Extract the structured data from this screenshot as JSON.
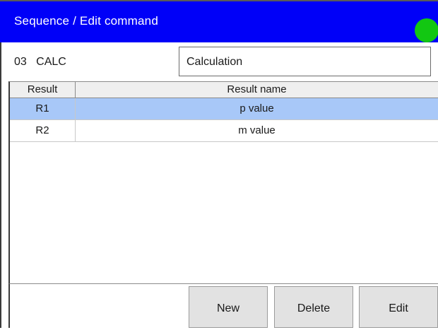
{
  "header": {
    "title": "Sequence / Edit command",
    "status_color": "#12c712"
  },
  "command": {
    "id_label": "03   CALC",
    "name": "Calculation"
  },
  "table": {
    "columns": [
      "Result",
      "Result name"
    ],
    "rows": [
      {
        "result": "R1",
        "name": "p value",
        "selected": true
      },
      {
        "result": "R2",
        "name": "m value",
        "selected": false
      }
    ]
  },
  "buttons": {
    "new_label": "New",
    "delete_label": "Delete",
    "edit_label": "Edit"
  },
  "colors": {
    "titlebar": "#0000f8",
    "selection": "#a8c8f8"
  }
}
